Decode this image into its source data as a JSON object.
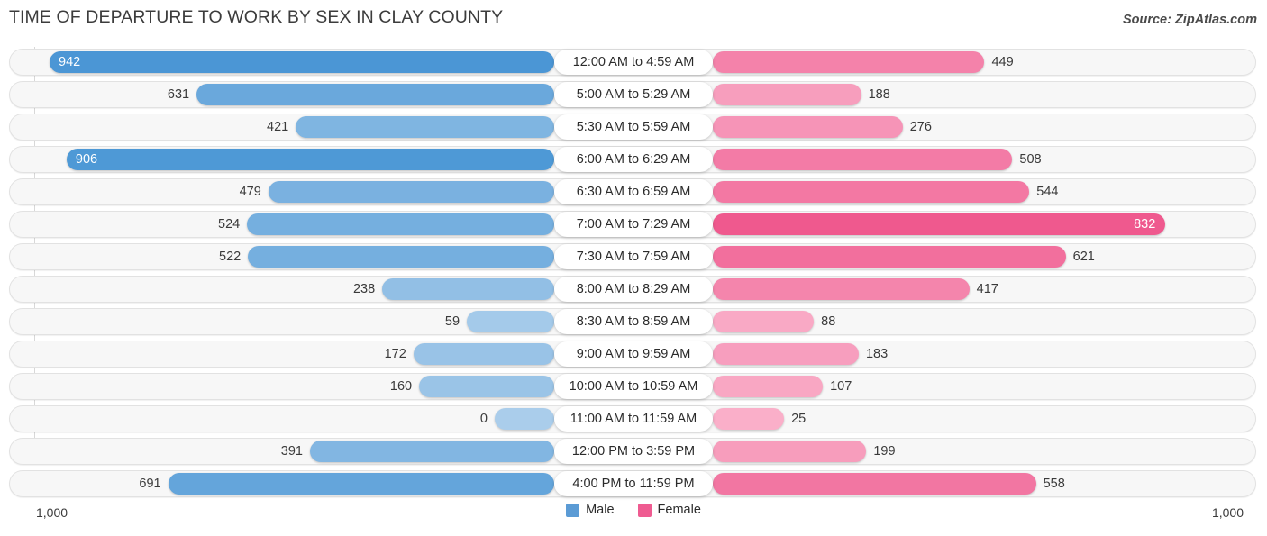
{
  "header": {
    "title": "TIME OF DEPARTURE TO WORK BY SEX IN CLAY COUNTY",
    "source": "Source: ZipAtlas.com"
  },
  "axis": {
    "left_label": "1,000",
    "right_label": "1,000"
  },
  "legend": {
    "items": [
      {
        "label": "Male",
        "color": "#5b9bd5",
        "icon": "square-swatch-icon"
      },
      {
        "label": "Female",
        "color": "#ef5b91",
        "icon": "square-swatch-icon"
      }
    ]
  },
  "colors": {
    "male": "#5b9bd5",
    "female": "#ef5b91",
    "track": "#f7f7f7",
    "gridline": "#d8d8d8",
    "title_text": "#3c3c3c"
  },
  "chart_data": {
    "type": "bar",
    "subtype": "diverging-horizontal-bar",
    "title": "TIME OF DEPARTURE TO WORK BY SEX IN CLAY COUNTY",
    "subtitle": "",
    "xlabel": "",
    "ylabel": "",
    "grid": true,
    "legend_position": "bottom-center",
    "axis_max": 1000,
    "axis_tick_labels": [
      "1,000",
      "1,000"
    ],
    "categories": [
      "12:00 AM to 4:59 AM",
      "5:00 AM to 5:29 AM",
      "5:30 AM to 5:59 AM",
      "6:00 AM to 6:29 AM",
      "6:30 AM to 6:59 AM",
      "7:00 AM to 7:29 AM",
      "7:30 AM to 7:59 AM",
      "8:00 AM to 8:29 AM",
      "8:30 AM to 8:59 AM",
      "9:00 AM to 9:59 AM",
      "10:00 AM to 10:59 AM",
      "11:00 AM to 11:59 AM",
      "12:00 PM to 3:59 PM",
      "4:00 PM to 11:59 PM"
    ],
    "series": [
      {
        "name": "Male",
        "color": "#5b9bd5",
        "side": "left",
        "values": [
          942,
          631,
          421,
          906,
          479,
          524,
          522,
          238,
          59,
          172,
          160,
          0,
          391,
          691
        ],
        "labels": [
          "942",
          "631",
          "421",
          "906",
          "479",
          "524",
          "522",
          "238",
          "59",
          "172",
          "160",
          "0",
          "391",
          "691"
        ]
      },
      {
        "name": "Female",
        "color": "#ef5b91",
        "side": "right",
        "values": [
          449,
          188,
          276,
          508,
          544,
          832,
          621,
          417,
          88,
          183,
          107,
          25,
          199,
          558
        ],
        "labels": [
          "449",
          "188",
          "276",
          "508",
          "544",
          "832",
          "621",
          "417",
          "88",
          "183",
          "107",
          "25",
          "199",
          "558"
        ]
      }
    ]
  }
}
